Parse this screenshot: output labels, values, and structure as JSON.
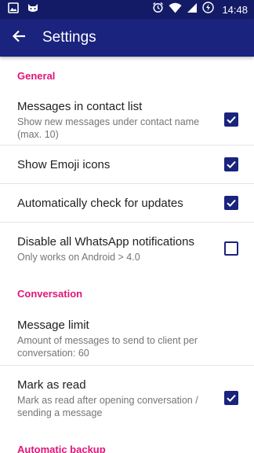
{
  "status_bar": {
    "time": "14:48",
    "left_icons": [
      "image-icon",
      "cat-icon"
    ],
    "right_icons": [
      "alarm-icon",
      "wifi-icon",
      "signal-icon",
      "battery-icon"
    ]
  },
  "app_bar": {
    "title": "Settings",
    "back_icon": "arrow-back-icon",
    "color": "#1a237e"
  },
  "accent_color": "#e0157a",
  "sections": {
    "general": {
      "header": "General",
      "items": [
        {
          "title": "Messages in contact list",
          "summary": "Show new messages under contact name (max. 10)",
          "checked": true
        },
        {
          "title": "Show Emoji icons",
          "summary": "",
          "checked": true
        },
        {
          "title": "Automatically check for updates",
          "summary": "",
          "checked": true
        },
        {
          "title": "Disable all WhatsApp notifications",
          "summary": "Only works on Android > 4.0",
          "checked": false
        }
      ]
    },
    "conversation": {
      "header": "Conversation",
      "items": [
        {
          "title": "Message limit",
          "summary": "Amount of messages to send to client per conversation:  60"
        },
        {
          "title": "Mark as read",
          "summary": "Mark as read after opening conversation / sending a message",
          "checked": true
        }
      ]
    },
    "automatic_backup": {
      "header": "Automatic backup"
    }
  }
}
